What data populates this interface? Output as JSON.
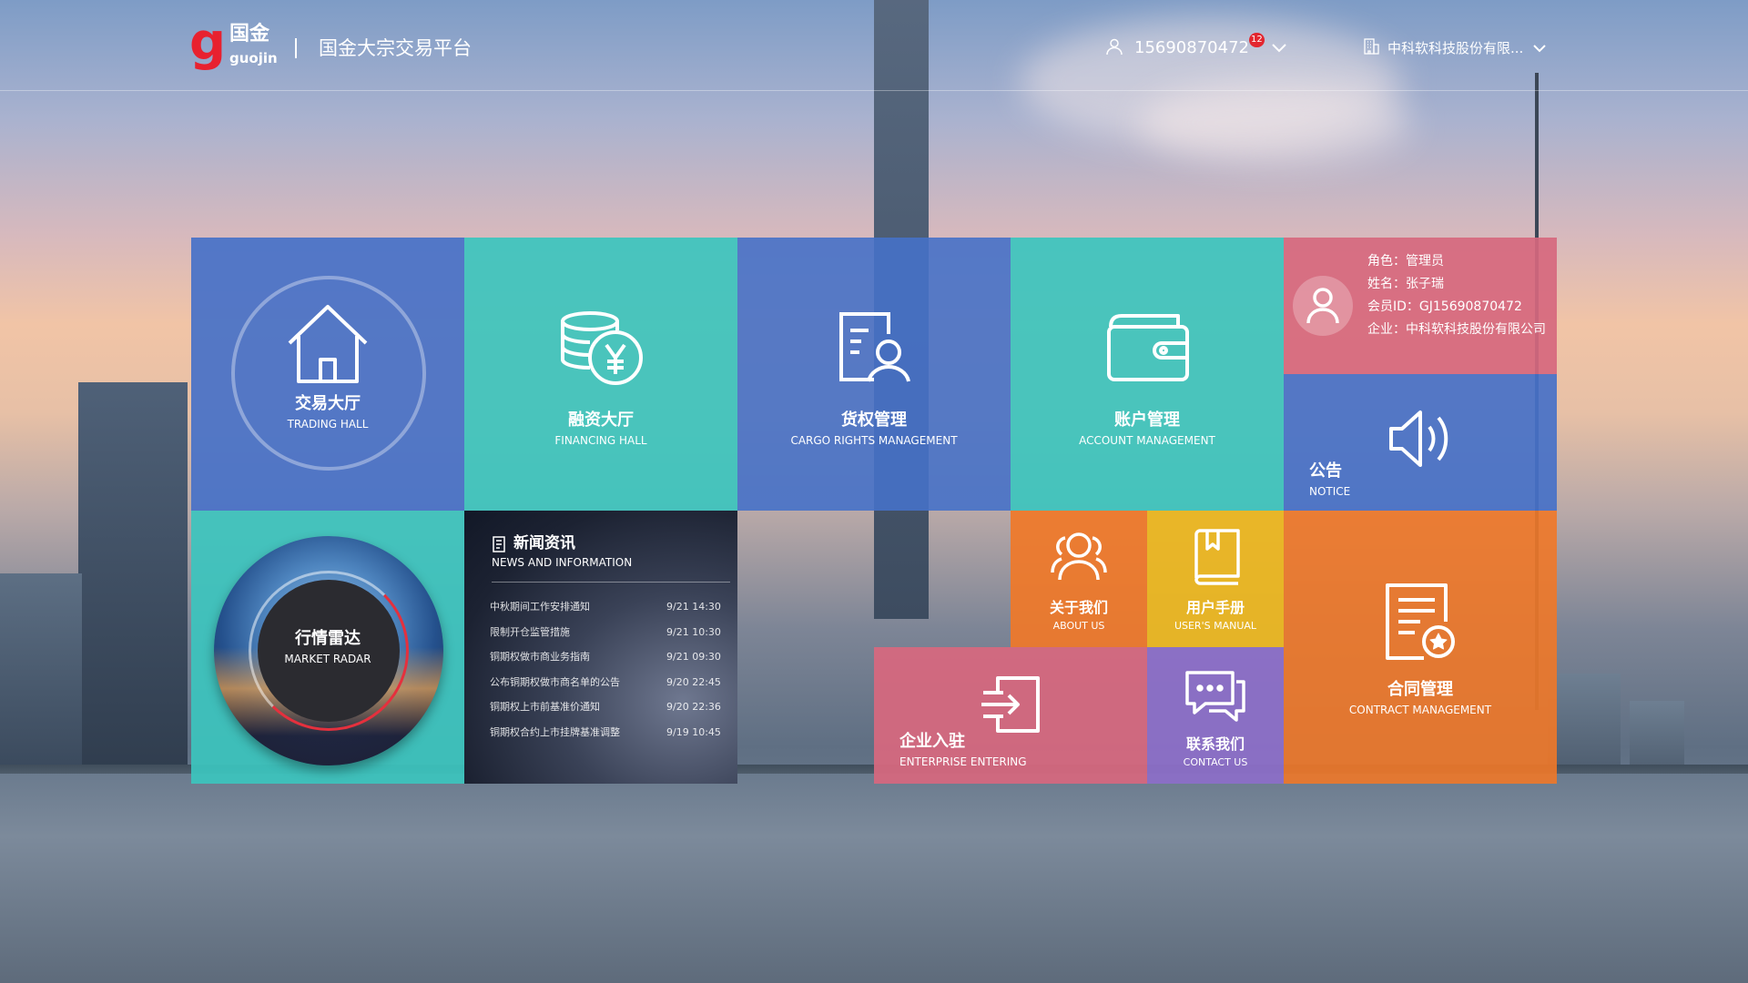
{
  "header": {
    "logo": {
      "cn": "国金",
      "en": "guojin",
      "mark": "g"
    },
    "platform_title": "国金大宗交易平台",
    "user": {
      "phone": "15690870472",
      "badge_count": "12"
    },
    "company": {
      "name": "中科软科技股份有限..."
    }
  },
  "tiles": {
    "trading": {
      "cn": "交易大厅",
      "en": "TRADING HALL"
    },
    "financing": {
      "cn": "融资大厅",
      "en": "FINANCING HALL"
    },
    "cargo": {
      "cn": "货权管理",
      "en": "CARGO RIGHTS MANAGEMENT"
    },
    "account": {
      "cn": "账户管理",
      "en": "ACCOUNT MANAGEMENT"
    },
    "notice": {
      "cn": "公告",
      "en": "NOTICE"
    },
    "radar": {
      "cn": "行情雷达",
      "en": "MARKET RADAR"
    },
    "about": {
      "cn": "关于我们",
      "en": "ABOUT US"
    },
    "manual": {
      "cn": "用户手册",
      "en": "USER'S MANUAL"
    },
    "contract": {
      "cn": "合同管理",
      "en": "CONTRACT MANAGEMENT"
    },
    "enterprise": {
      "cn": "企业入驻",
      "en": "ENTERPRISE ENTERING"
    },
    "contact": {
      "cn": "联系我们",
      "en": "CONTACT US"
    }
  },
  "profile": {
    "role": "角色：管理员",
    "name": "姓名：张子瑞",
    "member_id": "会员ID：GJ15690870472",
    "company": "企业：中科软科技股份有限公司"
  },
  "news": {
    "title_cn": "新闻资讯",
    "title_en": "NEWS AND INFORMATION",
    "items": [
      {
        "title": "中秋期间工作安排通知",
        "date": "9/21  14:30"
      },
      {
        "title": "限制开仓监管措施",
        "date": "9/21  10:30"
      },
      {
        "title": "铜期权做市商业务指南",
        "date": "9/21  09:30"
      },
      {
        "title": "公布铜期权做市商名单的公告",
        "date": "9/20  22:45"
      },
      {
        "title": "铜期权上市前基准价通知",
        "date": "9/20  22:36"
      },
      {
        "title": "铜期权合约上市挂牌基准调整",
        "date": "9/19  10:45"
      }
    ]
  },
  "icons": {
    "trading": "house-icon",
    "financing": "coins-yen-icon",
    "cargo": "document-person-icon",
    "account": "wallet-icon",
    "notice": "speaker-icon",
    "about": "group-icon",
    "manual": "book-icon",
    "contract": "contract-badge-icon",
    "enterprise": "enter-icon",
    "contact": "chat-bubble-icon"
  },
  "colors": {
    "blue_tile": "#4671c8",
    "teal_tile": "#3cc4be",
    "pink_tile": "#d6687e",
    "orange_tile": "#f07828",
    "yellow_tile": "#ecb720",
    "purple_tile": "#8c6ec8",
    "brand_red": "#e8212f"
  }
}
